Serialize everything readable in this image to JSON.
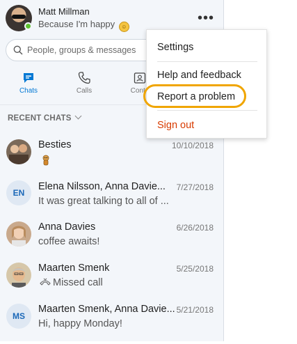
{
  "profile": {
    "name": "Matt Millman",
    "mood": "Because I'm happy",
    "mood_emoji": "☺"
  },
  "header": {
    "more_label": "•••"
  },
  "search": {
    "placeholder": "People, groups & messages"
  },
  "nav": {
    "tabs": [
      {
        "label": "Chats",
        "icon": "chat-icon",
        "active": true
      },
      {
        "label": "Calls",
        "icon": "phone-icon",
        "active": false
      },
      {
        "label": "Conta",
        "icon": "contacts-icon",
        "active": false
      }
    ]
  },
  "recent": {
    "header": "RECENT CHATS",
    "chats": [
      {
        "name": "Besties",
        "preview": "",
        "date": "10/10/2018",
        "avatar": "group-photo"
      },
      {
        "name": "Elena Nilsson, Anna Davie...",
        "preview": "It was great talking to all of ...",
        "date": "7/27/2018",
        "avatar_initials": "EN"
      },
      {
        "name": "Anna Davies",
        "preview": "coffee awaits!",
        "date": "6/26/2018",
        "avatar": "photo"
      },
      {
        "name": "Maarten Smenk",
        "preview": "Missed call",
        "date": "5/25/2018",
        "avatar": "photo",
        "preview_icon": "missed-call-icon"
      },
      {
        "name": "Maarten Smenk, Anna Davie...",
        "preview": "Hi, happy Monday!",
        "date": "5/21/2018",
        "avatar_initials": "MS"
      }
    ]
  },
  "menu": {
    "items": [
      {
        "label": "Settings"
      },
      {
        "label": "Help and feedback"
      },
      {
        "label": "Report a problem",
        "highlighted": true
      },
      {
        "label": "Sign out",
        "color": "#d83b01"
      }
    ]
  },
  "colors": {
    "accent": "#0078d4",
    "presence": "#5cc12e",
    "highlight": "#f0a500",
    "sign_out": "#d83b01"
  }
}
